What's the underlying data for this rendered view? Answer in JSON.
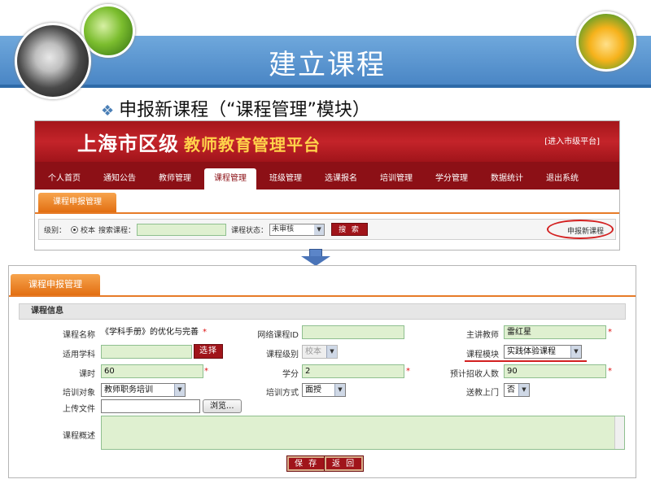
{
  "slide": {
    "title": "建立课程",
    "bullet": "申报新课程（“课程管理”模块）",
    "bullet_icon": "diamond-bullet-icon",
    "accent_color": "#4a86c5"
  },
  "portal": {
    "title_main": "上海市区级",
    "title_sub": "教师教育管理平台",
    "enter_link": "[进入市级平台]",
    "nav": [
      "个人首页",
      "通知公告",
      "教师管理",
      "课程管理",
      "班级管理",
      "选课报名",
      "培训管理",
      "学分管理",
      "数据统计",
      "退出系统"
    ],
    "active_nav": "课程管理",
    "subtab": "课程申报管理",
    "search": {
      "level_label": "级别：",
      "level_option": "校本",
      "course_label": "搜索课程：",
      "status_label": "课程状态：",
      "status_value": "未审核",
      "search_button": "搜 索",
      "new_course_link": "申报新课程"
    },
    "brand_color": "#a0141a",
    "tab_color": "#e77b27"
  },
  "form": {
    "tab": "课程申报管理",
    "section": "课程信息",
    "labels": {
      "name": "课程名称",
      "online_id": "网络课程ID",
      "teacher": "主讲教师",
      "subject": "适用学科",
      "level": "课程级别",
      "module": "课程模块",
      "hours": "课时",
      "credit": "学分",
      "max_enroll": "预计招收人数",
      "target": "培训对象",
      "method": "培训方式",
      "delivery": "送教上门",
      "upload": "上传文件",
      "summary": "课程概述"
    },
    "values": {
      "name": "《学科手册》的优化与完善",
      "online_id": "",
      "teacher": "雷红星",
      "subject": "",
      "level": "校本",
      "module": "实践体验课程",
      "hours": "60",
      "credit": "2",
      "max_enroll": "90",
      "target": "教师职务培训",
      "method": "面授",
      "delivery": "否",
      "upload": "",
      "summary": ""
    },
    "buttons": {
      "choose": "选择",
      "browse": "浏览...",
      "save": "保 存",
      "back": "返 回"
    },
    "required_mark": "*"
  }
}
